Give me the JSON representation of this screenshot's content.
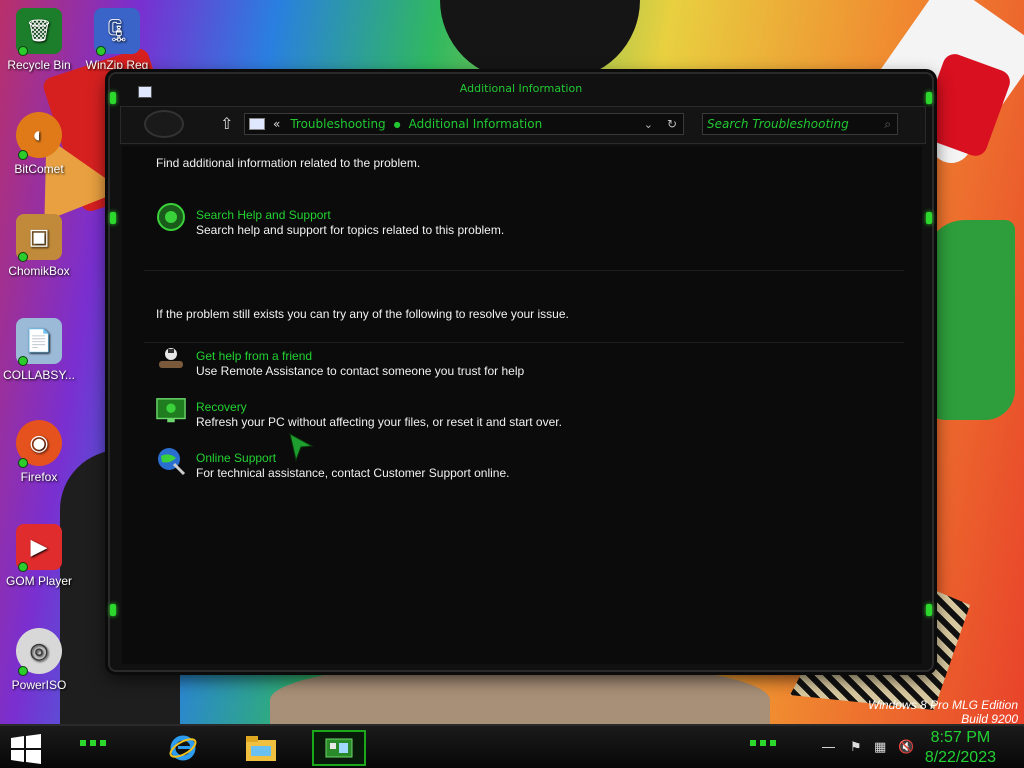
{
  "desktop": {
    "icons": [
      {
        "label": "Recycle Bin",
        "glyph": "trash-icon",
        "color": "#1c7d2a"
      },
      {
        "label": "WinZip Reg",
        "glyph": "winzip-icon",
        "color": "#3a64c8"
      },
      {
        "label": "BitComet",
        "glyph": "bitcomet-icon",
        "color": "#e07a18"
      },
      {
        "label": "ChomikBox",
        "glyph": "chomikbox-icon",
        "color": "#c08a3a"
      },
      {
        "label": "COLLABSY...",
        "glyph": "file-icon",
        "color": "#9bbad8"
      },
      {
        "label": "Firefox",
        "glyph": "firefox-icon",
        "color": "#e5521e"
      },
      {
        "label": "GOM Player",
        "glyph": "gom-player-icon",
        "color": "#e02c2c"
      },
      {
        "label": "PowerISO",
        "glyph": "disc-icon",
        "color": "#d8d8d8"
      }
    ],
    "brand_line1": "Windows 8 Pro MLG Edition",
    "brand_line2": "Build 9200"
  },
  "window": {
    "title": "Additional Information",
    "breadcrumb": [
      "Troubleshooting",
      "Additional Information"
    ],
    "breadcrumb_chevron": "«",
    "search_placeholder": "Search Troubleshooting",
    "intro": "Find additional information related to the problem.",
    "help": {
      "title": "Search Help and Support",
      "desc": "Search help and support for topics related to this problem."
    },
    "resolve_intro": "If the problem still exists you can try any of the following to resolve your issue.",
    "options": [
      {
        "title": "Get help from a friend",
        "desc": "Use Remote Assistance to contact someone you trust for help",
        "icon": "remote-assistance-icon"
      },
      {
        "title": "Recovery",
        "desc": "Refresh your PC without affecting your files, or reset it and start over.",
        "icon": "recovery-icon"
      },
      {
        "title": "Online Support",
        "desc": "For technical assistance, contact Customer Support online.",
        "icon": "online-support-icon"
      }
    ]
  },
  "taskbar": {
    "time": "8:57 PM",
    "date": "8/22/2023",
    "apps": [
      "internet-explorer-icon",
      "file-explorer-icon",
      "control-panel-icon"
    ]
  },
  "colors": {
    "accent": "#22d232",
    "window_bg": "#0b0b0b",
    "text": "#f2f2f2"
  }
}
